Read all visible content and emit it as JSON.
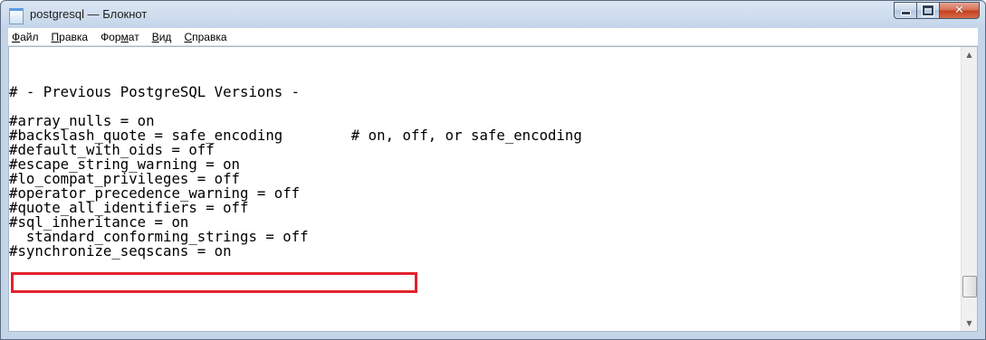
{
  "window": {
    "title": "postgresql — Блокнот",
    "close_glyph": "✕"
  },
  "menu": [
    {
      "pre": "",
      "u": "Ф",
      "post": "айл"
    },
    {
      "pre": "",
      "u": "П",
      "post": "равка"
    },
    {
      "pre": "Фор",
      "u": "м",
      "post": "ат"
    },
    {
      "pre": "",
      "u": "В",
      "post": "ид"
    },
    {
      "pre": "",
      "u": "С",
      "post": "правка"
    }
  ],
  "editor": {
    "lines": [
      "# - Previous PostgreSQL Versions -",
      "",
      "#array_nulls = on",
      "#backslash_quote = safe_encoding        # on, off, or safe_encoding",
      "#default_with_oids = off",
      "#escape_string_warning = on",
      "#lo_compat_privileges = off",
      "#operator_precedence_warning = off",
      "#quote_all_identifiers = off",
      "#sql_inheritance = on",
      "  standard_conforming_strings = off",
      "#synchronize_seqscans = on"
    ],
    "highlight_color": "#e0232d"
  },
  "scrollbar": {
    "up_glyph": "▲",
    "down_glyph": "▼"
  }
}
